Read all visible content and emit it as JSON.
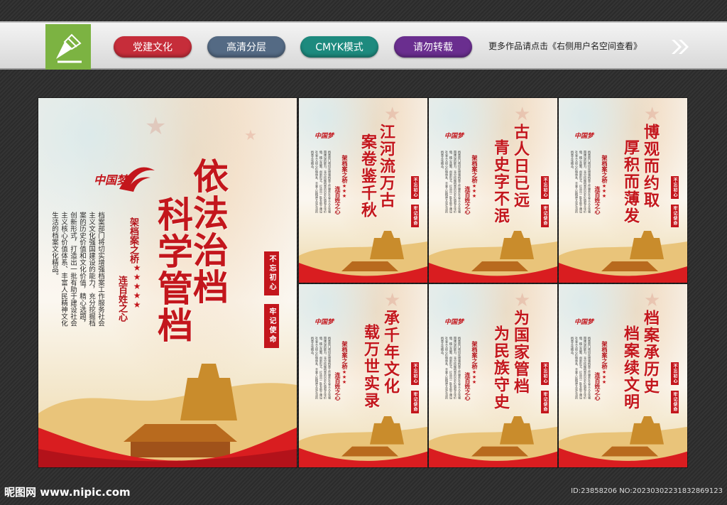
{
  "header": {
    "logo_icon": "pen-nib-logo-icon",
    "pills": [
      "党建文化",
      "高清分层",
      "CMYK模式",
      "请勿转载"
    ],
    "more_text": "更多作品请点击《右侧用户名空间查看》",
    "arrow_icon": "double-chevron-right-icon"
  },
  "main_poster": {
    "brand": "中国梦",
    "title_col1": "依法治档",
    "title_col2": "科学管档",
    "subtitle_col1": "架档案之桥",
    "subtitle_col2": "连百姓之心",
    "body": "档案部门将切实增强档案工作服务社会主义文化强国建设的能力，充分挖掘档案的历史价值和文化价值，精心选题，创新形式，打造出一批有助于建设社会主义核心价值体系、丰富人民精神文化生活的档案文化精品。",
    "slogan1": "不忘初心",
    "slogan2": "牢记使命"
  },
  "small_posters": [
    {
      "title_col1": "江河流万古",
      "title_col2": "案卷鉴千秋"
    },
    {
      "title_col1": "古人日已远",
      "title_col2": "青史字不泯"
    },
    {
      "title_col1": "博观而约取",
      "title_col2": "厚积而薄发"
    },
    {
      "title_col1": "承千年文化",
      "title_col2": "载万世实录"
    },
    {
      "title_col1": "为国家管档",
      "title_col2": "为民族守史"
    },
    {
      "title_col1": "档案承历史",
      "title_col2": "档案续文明"
    }
  ],
  "small_common": {
    "brand": "中国梦",
    "subtitle_col1": "架档案之桥",
    "subtitle_col2": "连百姓之心",
    "slogan1": "不忘初心",
    "slogan2": "牢记使命"
  },
  "footer": {
    "site": "昵图网 www.nipic.com",
    "id": "ID:23858206 NO:20230302231832869123"
  },
  "colors": {
    "accent_red": "#c3161c",
    "logo_green": "#7cb342"
  }
}
